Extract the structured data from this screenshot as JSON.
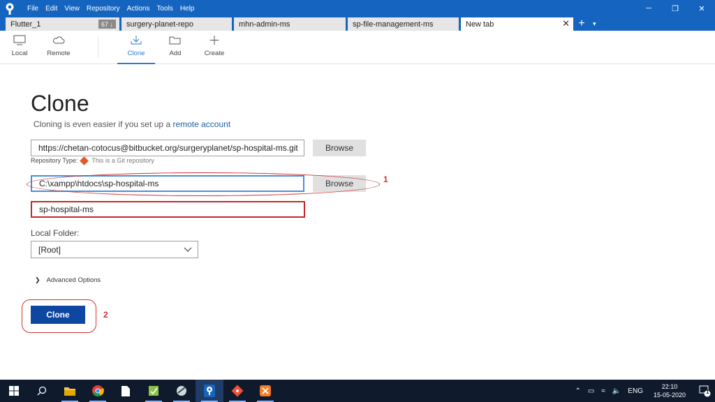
{
  "menu": [
    "File",
    "Edit",
    "View",
    "Repository",
    "Actions",
    "Tools",
    "Help"
  ],
  "window_controls": {
    "minimize": "─",
    "maximize": "❐",
    "close": "✕"
  },
  "tabs": [
    {
      "label": "Flutter_1",
      "badge": "67 ↓"
    },
    {
      "label": "surgery-planet-repo"
    },
    {
      "label": "mhn-admin-ms"
    },
    {
      "label": "sp-file-management-ms"
    },
    {
      "label": "New tab",
      "close": "✕"
    }
  ],
  "tab_add": "+",
  "tab_more": "▾",
  "toolbar": {
    "local": "Local",
    "remote": "Remote",
    "clone": "Clone",
    "add": "Add",
    "create": "Create"
  },
  "page": {
    "title": "Clone",
    "subtitle_prefix": "Cloning is even easier if you set up a ",
    "subtitle_link": "remote account"
  },
  "source_url": "https://chetan-cotocus@bitbucket.org/surgeryplanet/sp-hospital-ms.git",
  "browse_label": "Browse",
  "repo_type_label": "Repository Type:",
  "repo_type_value": "This is a Git repository",
  "destination_path": "C:\\xampp\\htdocs\\sp-hospital-ms",
  "name_value": "sp-hospital-ms",
  "local_folder_label": "Local Folder:",
  "local_folder_value": "[Root]",
  "advanced_label": "Advanced Options",
  "clone_button": "Clone",
  "annotations": {
    "one": "1",
    "two": "2"
  },
  "taskbar": {
    "lang": "ENG",
    "time": "22:10",
    "date": "15-05-2020",
    "notification_count": "1"
  },
  "colors": {
    "accent": "#1565c0",
    "clone_button": "#0d47a1",
    "annotation": "#d32f2f"
  }
}
